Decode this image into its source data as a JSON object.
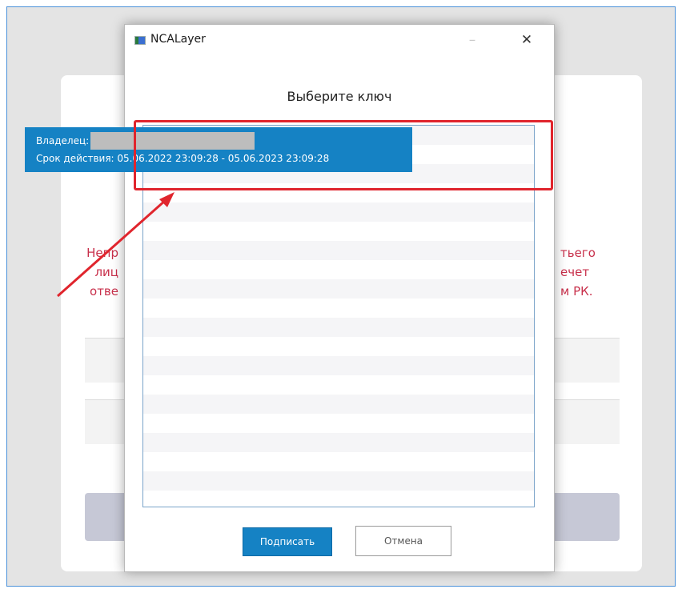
{
  "window": {
    "title": "NCALayer",
    "minimize_glyph": "–",
    "close_glyph": "✕"
  },
  "dialog": {
    "heading": "Выберите ключ",
    "selected_key": {
      "owner_label": "Владелец:",
      "validity_text": "Срок действия: 05.06.2022 23:09:28 - 05.06.2023 23:09:28"
    },
    "buttons": {
      "select": "Подписать",
      "cancel": "Отмена"
    }
  },
  "background_page": {
    "left_text": [
      "Непр",
      "лиц",
      "отве"
    ],
    "right_text": [
      "тьего",
      "ечет",
      "м РК."
    ]
  },
  "colors": {
    "accent": "#1582c4",
    "highlight": "#e0252d",
    "warning_text": "#c8304b"
  }
}
